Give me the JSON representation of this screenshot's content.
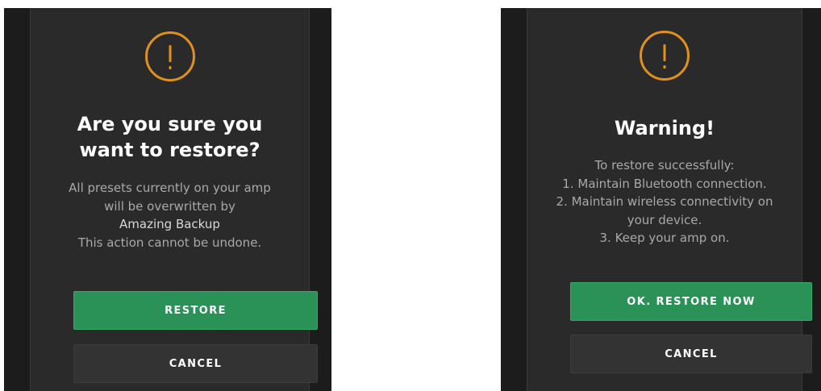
{
  "colors": {
    "background": "#1c1c1c",
    "panel": "#2a2a2a",
    "warning_accent": "#e0901c",
    "primary_button": "#2a9157",
    "secondary_button": "#333333",
    "title_text": "#ffffff",
    "body_text": "#a9a9a9"
  },
  "restore_confirm": {
    "icon": "warning-icon",
    "title_line1": "Are you sure you",
    "title_line2": "want to restore?",
    "message_line1": "All presets currently on your amp",
    "message_line2": "will be overwritten by",
    "backup_name": "Amazing Backup",
    "message_line4": "This action cannot be undone.",
    "restore_label": "RESTORE",
    "cancel_label": "CANCEL"
  },
  "restore_warning": {
    "icon": "warning-icon",
    "title": "Warning!",
    "message_line1": "To restore successfully:",
    "message_line2": "1. Maintain Bluetooth connection.",
    "message_line3": "2. Maintain wireless connectivity on",
    "message_line4": "your device.",
    "message_line5": "3. Keep your amp on.",
    "confirm_label": "OK. RESTORE NOW",
    "cancel_label": "CANCEL"
  }
}
